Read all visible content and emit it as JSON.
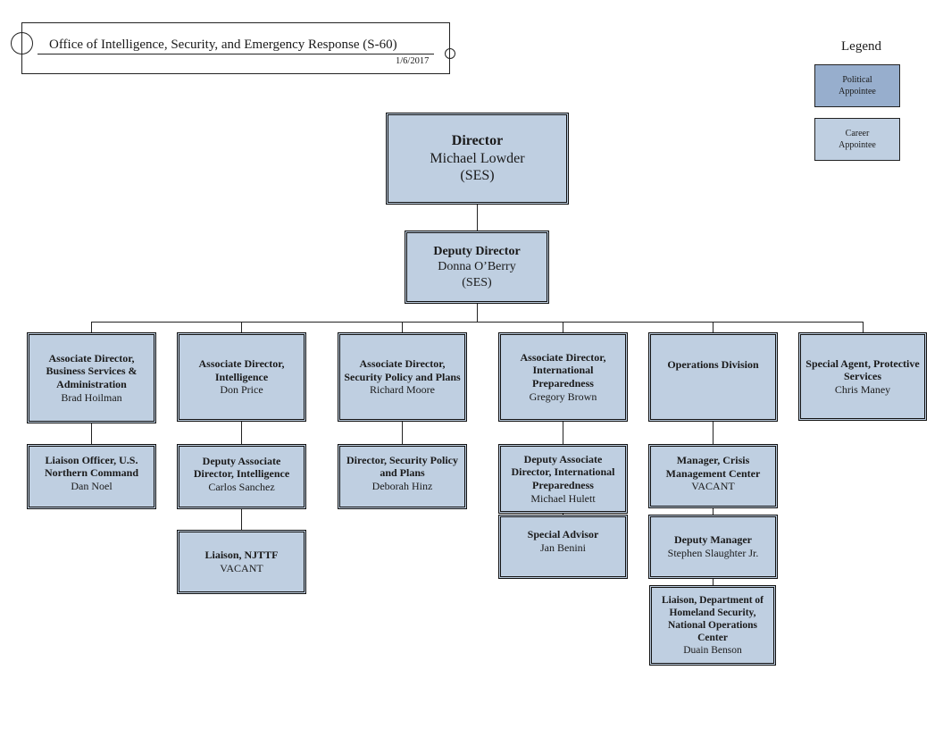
{
  "header": {
    "title": "Office of Intelligence, Security, and Emergency Response (S-60)",
    "date": "1/6/2017"
  },
  "legend": {
    "title": "Legend",
    "items": [
      {
        "label_line1": "Political",
        "label_line2": "Appointee",
        "color": "#97aecd"
      },
      {
        "label_line1": "Career",
        "label_line2": "Appointee",
        "color": "#bfcfe1"
      }
    ]
  },
  "colors": {
    "career": "#bfcfe1",
    "political": "#97aecd",
    "line": "#222222"
  },
  "org": {
    "director": {
      "title": "Director",
      "name": "Michael Lowder",
      "note": "(SES)"
    },
    "deputy": {
      "title": "Deputy Director",
      "name": "Donna O’Berry",
      "note": "(SES)"
    },
    "divisions": [
      {
        "title": "Associate Director, Business Services & Administration",
        "name": "Brad Hoilman",
        "children": [
          {
            "title": "Liaison Officer, U.S. Northern Command",
            "name": "Dan Noel"
          }
        ]
      },
      {
        "title": "Associate Director, Intelligence",
        "name": "Don Price",
        "children": [
          {
            "title": "Deputy Associate Director, Intelligence",
            "name": "Carlos Sanchez"
          },
          {
            "title": "Liaison, NJTTF",
            "name": "VACANT"
          }
        ]
      },
      {
        "title": "Associate Director, Security Policy and Plans",
        "name": "Richard Moore",
        "children": [
          {
            "title": "Director, Security Policy and Plans",
            "name": "Deborah Hinz"
          }
        ]
      },
      {
        "title": "Associate Director, International Preparedness",
        "name": "Gregory Brown",
        "children": [
          {
            "title": "Deputy Associate Director, International Preparedness",
            "name": "Michael Hulett"
          },
          {
            "title": "Special Advisor",
            "name": "Jan Benini"
          }
        ]
      },
      {
        "title": "Operations Division",
        "name": "",
        "children": [
          {
            "title": "Manager, Crisis Management Center",
            "name": "VACANT"
          },
          {
            "title": "Deputy Manager",
            "name": "Stephen Slaughter Jr."
          },
          {
            "title": "Liaison, Department of Homeland Security, National Operations Center",
            "name": "Duain Benson"
          }
        ]
      },
      {
        "title": "Special Agent, Protective Services",
        "name": "Chris Maney",
        "children": []
      }
    ]
  }
}
